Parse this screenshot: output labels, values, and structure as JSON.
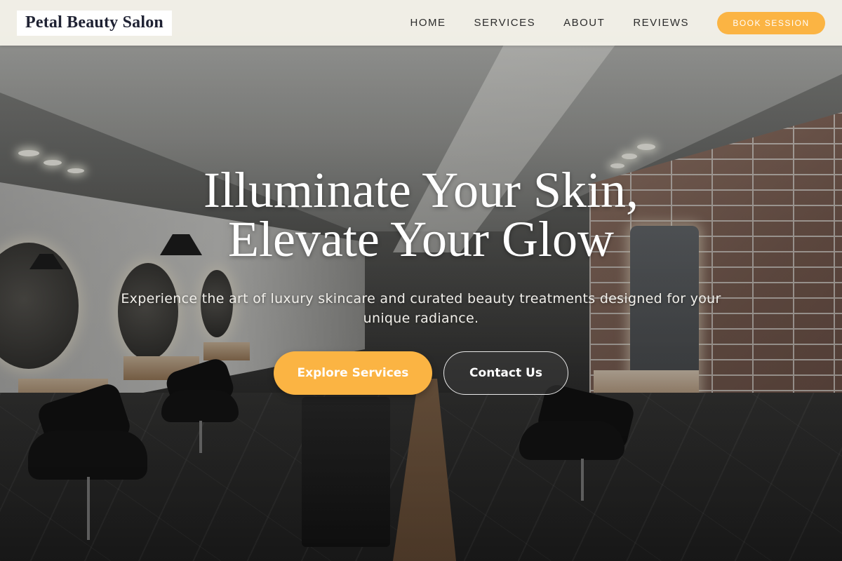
{
  "brand": {
    "name": "Petal Beauty Salon"
  },
  "nav": {
    "items": [
      {
        "label": "HOME"
      },
      {
        "label": "SERVICES"
      },
      {
        "label": "ABOUT"
      },
      {
        "label": "REVIEWS"
      }
    ],
    "cta_label": "BOOK SESSION"
  },
  "hero": {
    "headline_line1": "Illuminate Your Skin,",
    "headline_line2": "Elevate Your Glow",
    "subtitle": "Experience the art of luxury skincare and curated beauty treatments designed for your unique radiance.",
    "primary_cta": "Explore Services",
    "secondary_cta": "Contact Us"
  },
  "colors": {
    "accent": "#fbb443",
    "header_bg": "#f3f1e8",
    "logo_text": "#1f2233",
    "nav_text": "#2c2c2c"
  }
}
